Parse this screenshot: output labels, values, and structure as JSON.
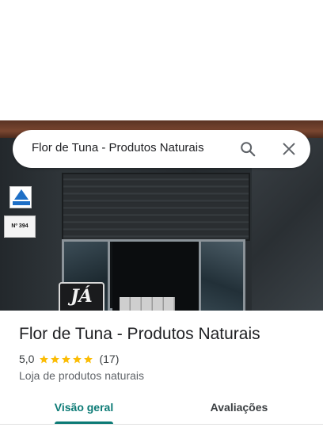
{
  "search": {
    "query": "Flor de Tuna - Produtos Naturais",
    "search_icon": "search-icon",
    "close_icon": "close-icon"
  },
  "photo": {
    "sign_text": "JÁ",
    "plaque_number": "Nº 394"
  },
  "place": {
    "title": "Flor de Tuna - Produtos Naturais",
    "rating": "5,0",
    "stars": 5,
    "review_count": "(17)",
    "category": "Loja de produtos naturais"
  },
  "tabs": [
    {
      "label": "Visão geral",
      "active": true
    },
    {
      "label": "Avaliações",
      "active": false
    }
  ],
  "colors": {
    "accent": "#0b7a75",
    "star": "#fbbc04",
    "title_text": "#202124",
    "secondary_text": "#5f6368"
  }
}
